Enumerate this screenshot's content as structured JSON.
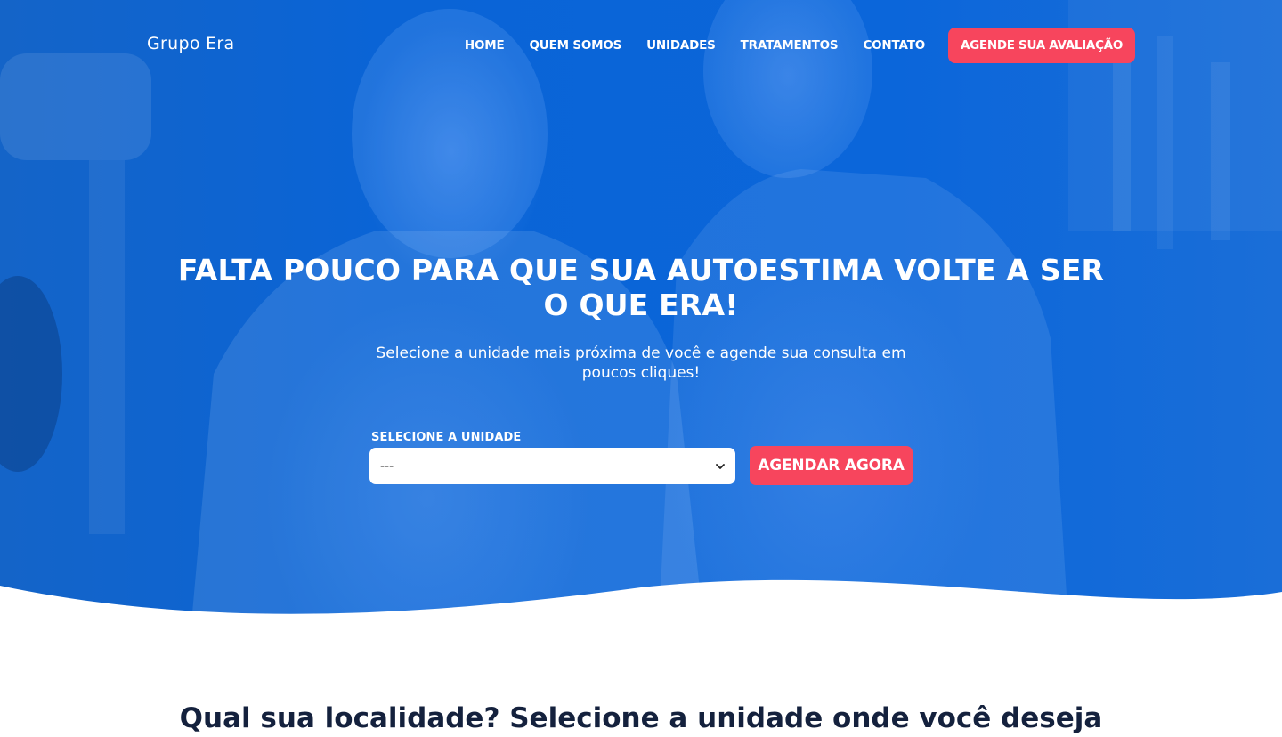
{
  "header": {
    "logo_text": "Grupo Era",
    "nav": {
      "home": "HOME",
      "quem_somos": "QUEM SOMOS",
      "unidades": "UNIDADES",
      "tratamentos": "TRATAMENTOS",
      "contato": "CONTATO"
    },
    "cta_label": "AGENDE SUA AVALIAÇÃO"
  },
  "hero": {
    "headline": "FALTA POUCO PARA QUE SUA AUTOESTIMA VOLTE A SER O QUE ERA!",
    "subheadline": "Selecione a unidade mais próxima de você e agende sua consulta em poucos cliques!",
    "background_image": "two smiling dentists in white coats in a clinic, blue duotone overlay",
    "form": {
      "select_label": "SELECIONE A UNIDADE",
      "select_value": "---",
      "button_label": "AGENDAR AGORA"
    }
  },
  "section": {
    "title": "Qual sua localidade? Selecione a unidade onde você deseja"
  },
  "icons": {
    "select_chevron": "chevron-down-icon"
  },
  "colors": {
    "hero_blue": "#0b66da",
    "accent_red": "#f7455d",
    "title_navy": "#14213d"
  }
}
